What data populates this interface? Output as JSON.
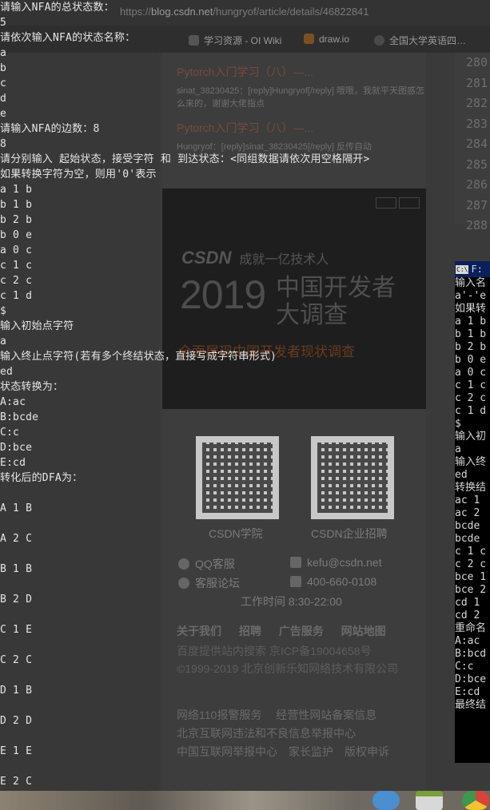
{
  "browser": {
    "url_prefix": "https://",
    "url_domain": "blog.csdn.net",
    "url_path": "/hungryof/article/details/46822841",
    "bookmarks": [
      {
        "label": "学习资源 - OI Wiki",
        "icon": "graduation-cap-icon"
      },
      {
        "label": "draw.io",
        "icon": "drawio-icon"
      },
      {
        "label": "全国大学英语四…",
        "icon": "globe-icon"
      }
    ],
    "articles": [
      {
        "title": "Pytorch入门学习（八）—...",
        "desc": "sinat_38230425：[reply]Hungryof[/reply] 哦哦，我就平天图惑怎么来的，谢谢大佬指点"
      },
      {
        "title": "Pytorch入门学习（八）—...",
        "desc": "Hungryof：[reply]sinat_38230425[/reply] 反传自动"
      }
    ],
    "line_numbers": [
      "280",
      "281",
      "282",
      "283",
      "284",
      "285",
      "286",
      "287",
      "288"
    ],
    "ad": {
      "logo": "CSDN",
      "logo_tagline": "成就一亿技术人",
      "year": "2019",
      "headline_1": "中国开发者",
      "headline_2": "大调查",
      "subline": "全面展现中国开发者现状调查"
    },
    "footer": {
      "qr1_label": "CSDN学院",
      "qr2_label": "CSDN企业招聘",
      "qq": "QQ客服",
      "email": "kefu@csdn.net",
      "forum": "客服论坛",
      "phone": "400-660-0108",
      "hours": "工作时间 8:30-22:00",
      "links": [
        "关于我们",
        "招聘",
        "广告服务",
        "网站地图"
      ],
      "icp": "百度提供站内搜索 京ICP备19004658号",
      "copyright": "©1999-2019 北京创新乐知网络技术有限公司",
      "bottom_1": "网络110报警服务　 经营性网站备案信息",
      "bottom_2": "北京互联网违法和不良信息举报中心",
      "bottom_3": "中国互联网举报中心　家长监护　版权申诉"
    }
  },
  "console": {
    "lines": [
      "请输入NFA的总状态数：",
      "5",
      "请依次输入NFA的状态名称：",
      "a",
      "b",
      "c",
      "d",
      "e",
      "请输入NFA的边数：8",
      "8",
      "请分别输入 起始状态，接受字符 和 到达状态：<同组数据请依次用空格隔开>",
      "如果转换字符为空，则用'0'表示",
      "a 1 b",
      "b 1 b",
      "b 2 b",
      "b 0 e",
      "a 0 c",
      "c 1 c",
      "c 2 c",
      "c 1 d",
      "$",
      "输入初始点字符",
      "a",
      "输入终止点字符(若有多个终结状态，直接写成字符串形式)",
      "ed",
      "状态转换为：",
      "A:ac",
      "B:bcde",
      "C:c",
      "D:bce",
      "E:cd",
      "转化后的DFA为：",
      "",
      "A 1 B",
      "",
      "A 2 C",
      "",
      "B 1 B",
      "",
      "B 2 D",
      "",
      "C 1 E",
      "",
      "C 2 C",
      "",
      "D 1 B",
      "",
      "D 2 D",
      "",
      "E 1 E",
      "",
      "E 2 C"
    ]
  },
  "console2": {
    "title": "F:",
    "title_icon": "C:\\",
    "lines": [
      "输入名",
      "a'-'e",
      "如果转",
      "a 1 b",
      "b 1 b",
      "b 2 b",
      "b 0 e",
      "a 0 c",
      "c 1 c",
      "c 2 c",
      "c 1 d",
      "$",
      "输入初",
      "a",
      "输入终",
      "ed",
      "转换结",
      "ac 1 ",
      "ac 2 ",
      "bcde ",
      "bcde ",
      "c 1 c",
      "c 2 c",
      "bce 1",
      "bce 2",
      "cd 1 ",
      "cd 2 ",
      "重命名",
      "A:ac",
      "B:bcd",
      "C:c",
      "D:bce",
      "E:cd",
      "最终结"
    ]
  },
  "colors": {
    "console_text": "#e6e6e6",
    "console2_title_bg": "#0b1f5a",
    "article_title": "#7a4a38"
  }
}
